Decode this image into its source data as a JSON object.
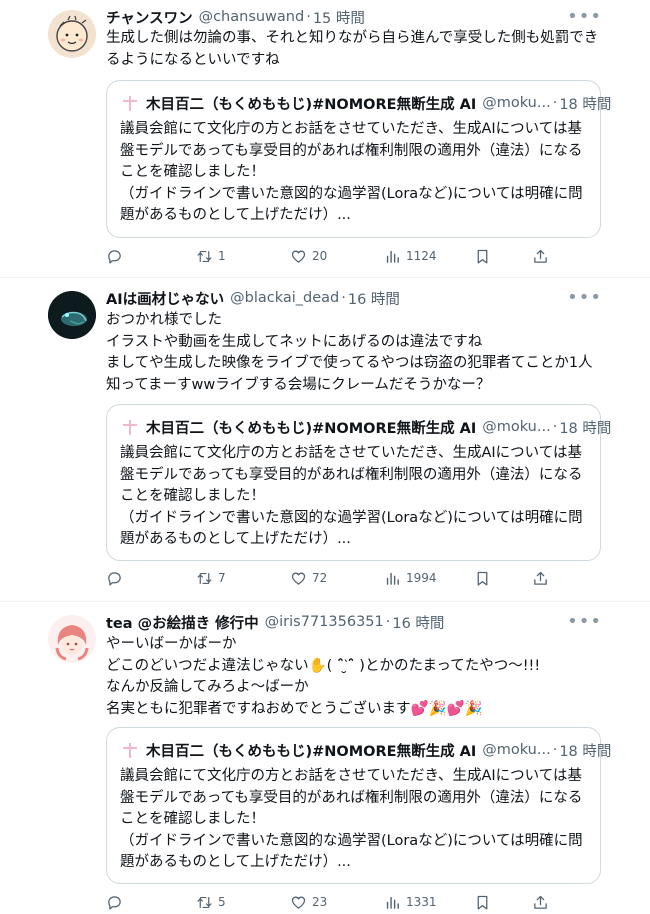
{
  "quoted": {
    "name": "木目百二（もくめももじ)#NOMORE無断生成 AI",
    "handle": "@moku...",
    "time": "18 時間",
    "lines": [
      "議員会館にて文化庁の方とお話をさせていただき、生成AIについては基",
      "盤モデルであっても享受目的があれば権利制限の適用外（違法）になる",
      "ことを確認しました！",
      "（ガイドラインで書いた意図的な過学習(Loraなど)については明確に問",
      "題があるものとして上げただけ）..."
    ]
  },
  "tweets": [
    {
      "name": "チャンスワン",
      "handle": "@chansuwand",
      "time": "15 時間",
      "lines": [
        "生成した側は勿論の事、それと知りながら自ら進んで享受した側も処罰でき",
        "るようになるといいですね"
      ],
      "replies": "",
      "retweets": "1",
      "likes": "20",
      "views": "1124"
    },
    {
      "name": "AIは画材じゃない",
      "handle": "@blackai_dead",
      "time": "16 時間",
      "lines": [
        "おつかれ様でした",
        "イラストや動画を生成してネットにあげるのは違法ですね",
        "ましてや生成した映像をライブで使ってるやつは窃盗の犯罪者てことか1人",
        "知ってまーすwwライブする会場にクレームだそうかなー？"
      ],
      "replies": "",
      "retweets": "7",
      "likes": "72",
      "views": "1994"
    },
    {
      "name": "tea @お絵描き 修行中",
      "handle": "@iris771356351",
      "time": "16 時間",
      "lines": [
        "やーいばーかばーか",
        "どこのどいつだよ違法じゃない✋( ˆ̑‵̮ˆ̑ )とかのたまってたやつ〜!!!",
        "なんか反論してみろよ〜ばーか",
        "名実ともに犯罪者ですねおめでとうございます💕🎉💕🎉"
      ],
      "replies": "",
      "retweets": "5",
      "likes": "23",
      "views": "1331"
    }
  ],
  "icons": {
    "reply": "reply-icon",
    "retweet": "retweet-icon",
    "like": "like-icon",
    "views": "views-icon",
    "bookmark": "bookmark-icon",
    "share": "share-icon",
    "more": "more-icon"
  },
  "colors": {
    "text": "#0f1419",
    "secondary": "#536471",
    "border": "#cfd9de"
  }
}
